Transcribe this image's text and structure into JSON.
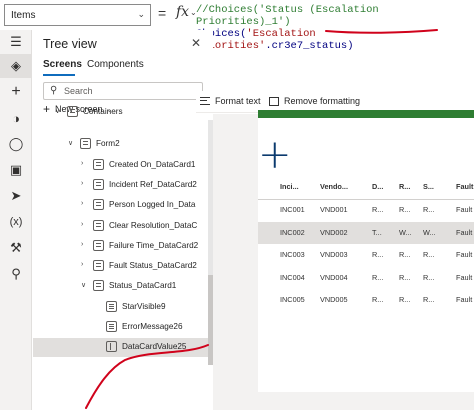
{
  "formula_bar": {
    "property": "Items",
    "equals": "=",
    "fx": "fx",
    "line1": "//Choices('Status (Escalation Priorities)_1')",
    "line2_prefix": "Choices(",
    "line2_string": "'Escalation Priorities'",
    "line2_suffix": ".cr3e7_status)"
  },
  "tree_view": {
    "title": "Tree view",
    "tabs": [
      "Screens",
      "Components"
    ],
    "search_placeholder": "Search",
    "new_screen": "New screen",
    "rows": [
      {
        "label": "Containers",
        "depth": 2,
        "icon": "form",
        "expanded": true,
        "partial": true
      },
      {
        "label": "Form2",
        "depth": 3,
        "icon": "form",
        "expanded": true
      },
      {
        "label": "Created On_DataCard1",
        "depth": 4,
        "icon": "form",
        "expanded": false
      },
      {
        "label": "Incident Ref_DataCard2",
        "depth": 4,
        "icon": "form",
        "expanded": false
      },
      {
        "label": "Person Logged In_Data",
        "depth": 4,
        "icon": "form",
        "expanded": false
      },
      {
        "label": "Clear Resolution_DataC",
        "depth": 4,
        "icon": "form",
        "expanded": false
      },
      {
        "label": "Failure Time_DataCard2",
        "depth": 4,
        "icon": "form",
        "expanded": false
      },
      {
        "label": "Fault Status_DataCard2",
        "depth": 4,
        "icon": "form",
        "expanded": false
      },
      {
        "label": "Status_DataCard1",
        "depth": 4,
        "icon": "form",
        "expanded": true
      },
      {
        "label": "StarVisible9",
        "depth": 5,
        "icon": "label"
      },
      {
        "label": "ErrorMessage26",
        "depth": 5,
        "icon": "label"
      },
      {
        "label": "DataCardValue25",
        "depth": 5,
        "icon": "dropdown",
        "selected": true
      }
    ]
  },
  "toolbar": {
    "format_text": "Format text",
    "remove_formatting": "Remove formatting"
  },
  "gallery": {
    "add_icon": "plus-icon",
    "columns": [
      "Inci...",
      "Vendo...",
      "D...",
      "R...",
      "S...",
      "Fault"
    ],
    "rows": [
      [
        "INC001",
        "VND001",
        "R...",
        "R...",
        "R...",
        "Fault"
      ],
      [
        "INC002",
        "VND002",
        "T...",
        "W...",
        "W...",
        "Fault"
      ],
      [
        "INC003",
        "VND003",
        "R...",
        "R...",
        "R...",
        "Fault"
      ],
      [
        "INC004",
        "VND004",
        "R...",
        "R...",
        "R...",
        "Fault"
      ],
      [
        "INC005",
        "VND005",
        "R...",
        "R...",
        "R...",
        "Fault"
      ]
    ],
    "selected_row": 1
  },
  "colors": {
    "accent": "#0f6cbd",
    "annotation": "#d0021b",
    "header_green": "#2e7d32"
  }
}
